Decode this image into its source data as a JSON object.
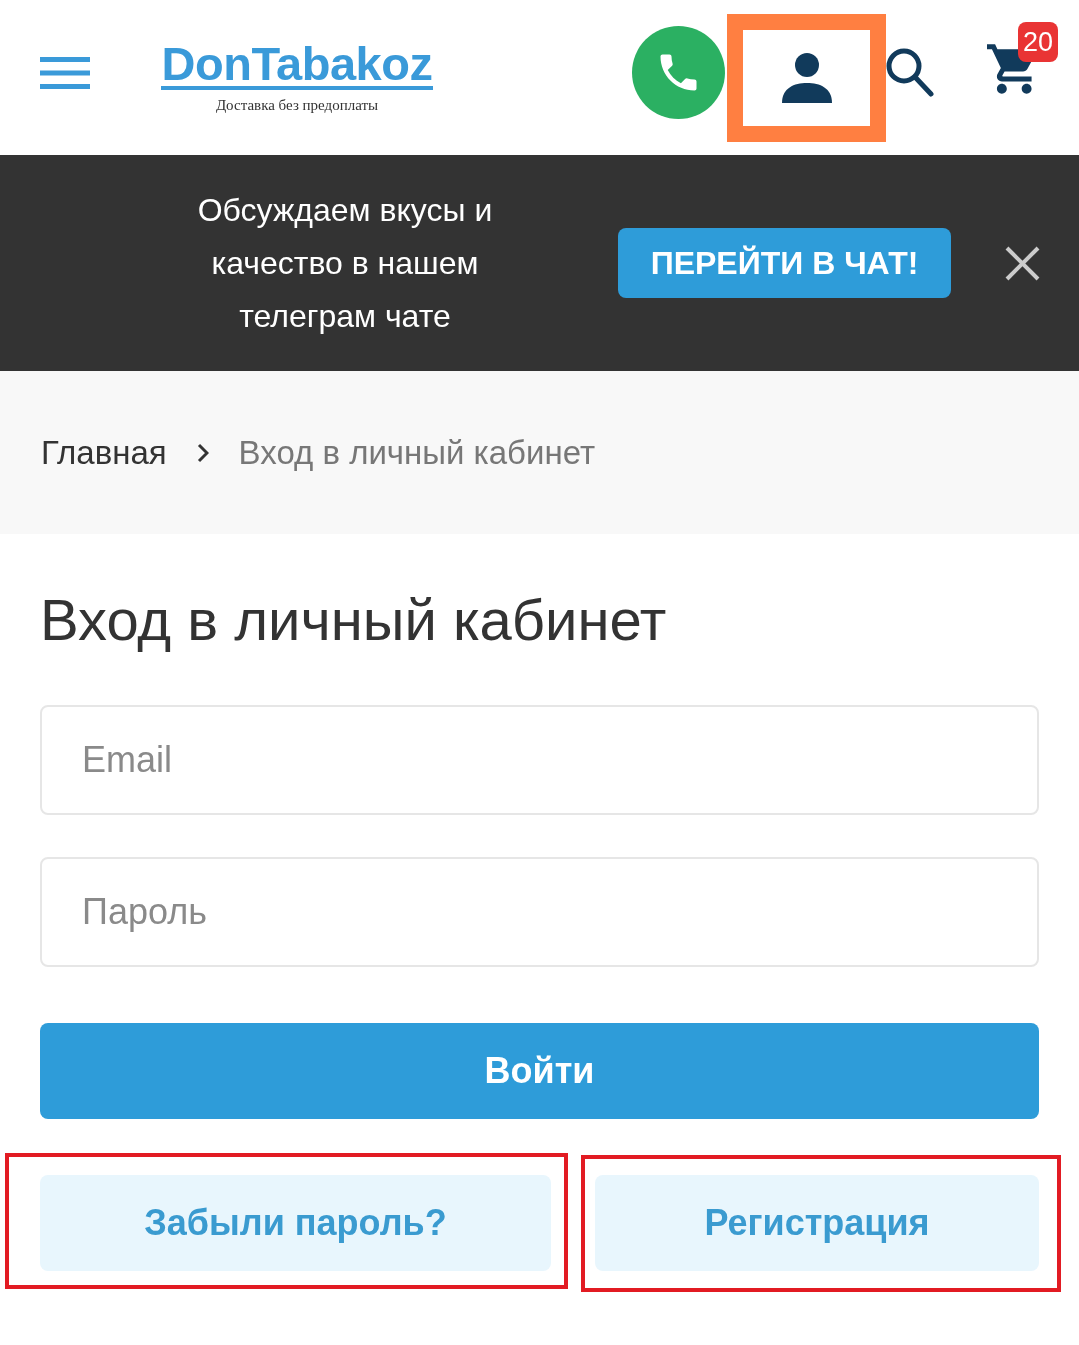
{
  "header": {
    "logo": {
      "name": "DonTabakoz",
      "tagline": "Доставка без предоплаты"
    },
    "actions": [
      {
        "kind": "phone",
        "highlighted": false
      },
      {
        "kind": "account",
        "highlighted": true
      },
      {
        "kind": "search",
        "highlighted": false
      },
      {
        "kind": "cart",
        "highlighted": false,
        "badge": "20"
      }
    ]
  },
  "banner": {
    "text": "Обсуждаем вкусы и качество в нашем телеграм чате",
    "button": "ПЕРЕЙТИ В ЧАТ!"
  },
  "breadcrumb": [
    {
      "label": "Главная",
      "current": false
    },
    {
      "label": "Вход в личный кабинет",
      "current": true
    }
  ],
  "form": {
    "title": "Вход в личный кабинет",
    "fields": [
      {
        "placeholder": "Email"
      },
      {
        "placeholder": "Пароль"
      }
    ],
    "submit": "Войти",
    "links": [
      {
        "label": "Забыли пароль?",
        "highlighted": true
      },
      {
        "label": "Регистрация",
        "highlighted": true
      }
    ]
  }
}
